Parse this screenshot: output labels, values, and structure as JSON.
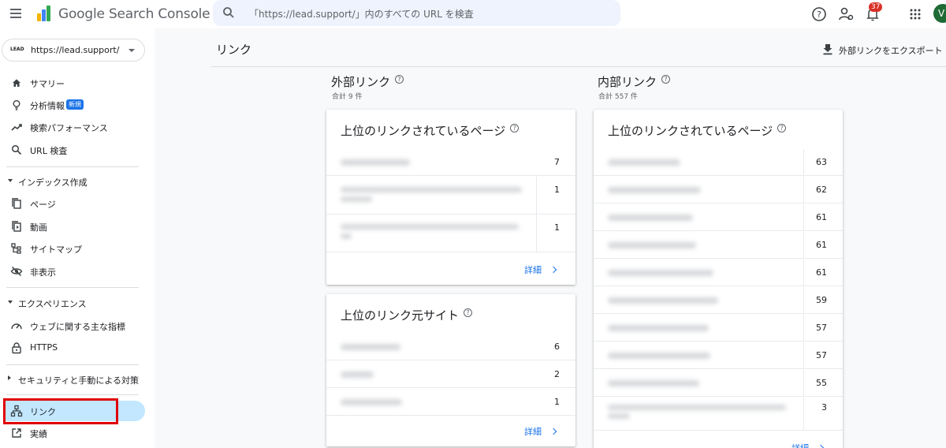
{
  "app": {
    "brand": "Google Search Console",
    "search_placeholder": "「https://lead.support/」内のすべての URL を検査",
    "notification_count": "37",
    "avatar_initial": "V"
  },
  "sidebar": {
    "property": {
      "favicon_text": "LEAD",
      "name": "https://lead.support/"
    },
    "items_top": [
      {
        "label": "サマリー",
        "icon": "home-icon"
      },
      {
        "label": "分析情報",
        "icon": "lightbulb-icon",
        "badge": "新規"
      },
      {
        "label": "検索パフォーマンス",
        "icon": "trending-icon"
      },
      {
        "label": "URL 検査",
        "icon": "search-icon"
      }
    ],
    "section_index": "インデックス作成",
    "items_index": [
      {
        "label": "ページ",
        "icon": "pages-icon"
      },
      {
        "label": "動画",
        "icon": "video-icon"
      },
      {
        "label": "サイトマップ",
        "icon": "sitemap-icon"
      },
      {
        "label": "非表示",
        "icon": "hidden-icon"
      }
    ],
    "section_experience": "エクスペリエンス",
    "items_experience": [
      {
        "label": "ウェブに関する主な指標",
        "icon": "gauge-icon"
      },
      {
        "label": "HTTPS",
        "icon": "lock-icon"
      }
    ],
    "section_security": "セキュリティと手動による対策",
    "items_bottom": [
      {
        "label": "リンク",
        "icon": "links-icon",
        "active": true
      },
      {
        "label": "実績",
        "icon": "open-in-new-icon"
      }
    ],
    "highlight_color": "#e00000"
  },
  "main": {
    "page_title": "リンク",
    "export_label": "外部リンクをエクスポート",
    "external": {
      "title": "外部リンク",
      "subtitle": "合計 9 件",
      "top_pages": {
        "title": "上位のリンクされているページ",
        "counts": [
          "7",
          "1",
          "1"
        ],
        "details": "詳細"
      },
      "top_sites": {
        "title": "上位のリンク元サイト",
        "counts": [
          "6",
          "2",
          "1"
        ],
        "details": "詳細"
      }
    },
    "internal": {
      "title": "内部リンク",
      "subtitle": "合計 557 件",
      "top_pages": {
        "title": "上位のリンクされているページ",
        "counts": [
          "63",
          "62",
          "61",
          "61",
          "61",
          "59",
          "57",
          "57",
          "55",
          "3"
        ],
        "details": "詳細"
      }
    }
  },
  "colors": {
    "accent": "#1a73e8",
    "active_nav": "#c2e7ff",
    "search_bg": "#eef3fd"
  }
}
